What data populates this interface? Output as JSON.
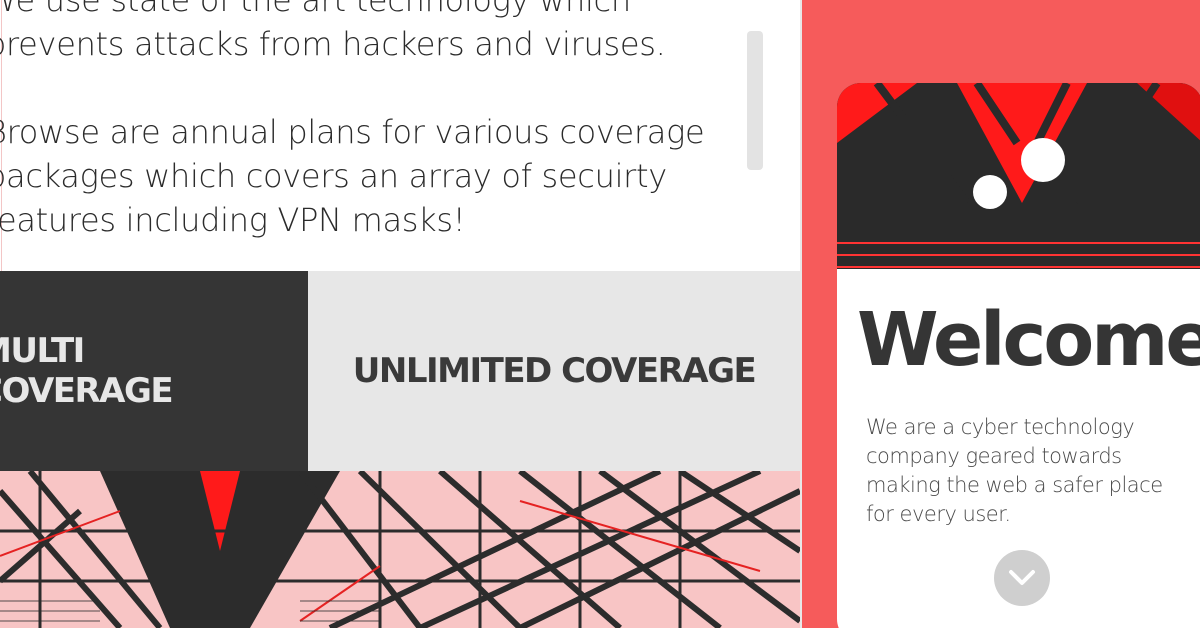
{
  "content": {
    "paragraphs": [
      "We use state of the art technology which prevents attacks from hackers and viruses.",
      "Browse are annual plans for various coverage packages which covers an array of secuirty features including VPN masks!"
    ]
  },
  "tabs": [
    {
      "label": "MULTI COVERAGE",
      "active": true
    },
    {
      "label": "UNLIMITED COVERAGE",
      "active": false
    }
  ],
  "card": {
    "title": "Welcome",
    "description": "We are a cyber technology company geared towards making the web a safer place for every user.",
    "scroll_icon": "chevron-down-icon"
  },
  "colors": {
    "accent": "#f65b5b",
    "dark": "#353535",
    "light": "#e7e7e7",
    "highlight_red": "#ff1a1a"
  }
}
